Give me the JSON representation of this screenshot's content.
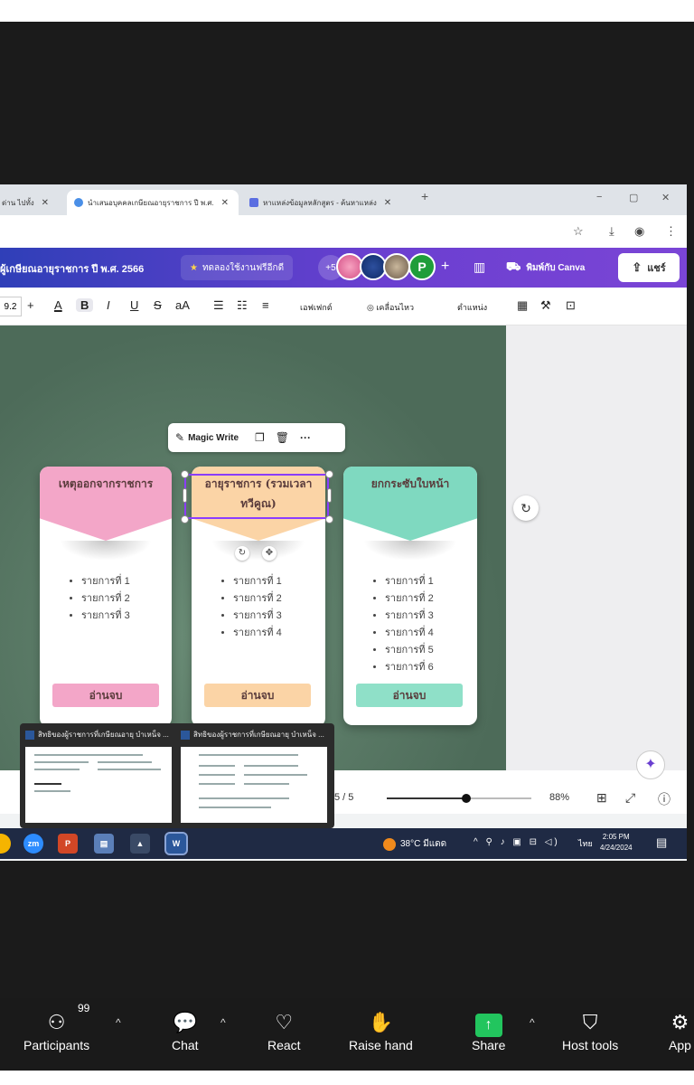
{
  "browser": {
    "tabs": [
      {
        "title": "ด่าน ไปทั้ง",
        "active": false
      },
      {
        "title": "นำเสนอบุคคลเกษียณอายุราชการ ปี พ.ศ.",
        "active": true
      },
      {
        "title": "หาแหล่งข้อมูลหลักสูตร - ค้นหาแหล่ง",
        "active": false
      }
    ],
    "new_tab": "+",
    "window_controls": [
      "−",
      "▢",
      "✕"
    ]
  },
  "canva": {
    "doc_title": "ผู้เกษียณอายุราชการ ปี พ.ศ. 2566",
    "trial_label": "ทดลองใช้งานฟรีอีกดี",
    "collaborators_extra": "+5",
    "avatar_letter": "P",
    "print_label": "พิมพ์กับ Canva",
    "share_label": "แชร์",
    "toolbar": {
      "font_size": "9.2",
      "effects_label": "เอฟเฟกต์",
      "animate_label": "เคลื่อนไหว",
      "position_label": "ตำแหน่ง"
    },
    "magic_write_label": "Magic Write",
    "pages_label": "5 / 5",
    "zoom_value": "88%",
    "zoom_level": 0.55
  },
  "cards": [
    {
      "title": "เหตุออกจากราชการ",
      "head_color": "#f3a6c8",
      "btn_color": "#f3a6c8",
      "items": [
        "รายการที่ 1",
        "รายการที่ 2",
        "รายการที่ 3"
      ],
      "button": "อ่านจบ"
    },
    {
      "title": "อายุราชการ (รวมเวลาทวีคูณ)",
      "head_color": "#fbd4a6",
      "btn_color": "#fbd4a6",
      "items": [
        "รายการที่ 1",
        "รายการที่ 2",
        "รายการที่ 3",
        "รายการที่ 4"
      ],
      "button": "อ่านจบ"
    },
    {
      "title": "ยกกระซับใบหน้า",
      "head_color": "#7fd9c0",
      "btn_color": "#8fe0c8",
      "items": [
        "รายการที่ 1",
        "รายการที่ 2",
        "รายการที่ 3",
        "รายการที่ 4",
        "รายการที่ 5",
        "รายการที่ 6"
      ],
      "button": "อ่านจบ"
    }
  ],
  "task_previews": [
    {
      "title": "สิทธิของผู้ราชการที่เกษียณอายุ บำเหน็จ ..."
    },
    {
      "title": "สิทธิของผู้ราชการที่เกษียณอายุ บำเหน็จ ..."
    }
  ],
  "taskbar": {
    "weather": "38°C มีแดด",
    "lang": "ไทย",
    "time": "2:05 PM",
    "date": "4/24/2024"
  },
  "zoom_controls": {
    "participants_label": "Participants",
    "participants_count": "99",
    "chat_label": "Chat",
    "react_label": "React",
    "raise_hand_label": "Raise hand",
    "share_label": "Share",
    "host_tools_label": "Host tools",
    "apps_label": "App"
  },
  "colors": {
    "canva_header": "#6a3fd0",
    "design_bg": "#4d6b59",
    "selection": "#8b3dff",
    "zoom_share": "#22c55e"
  }
}
